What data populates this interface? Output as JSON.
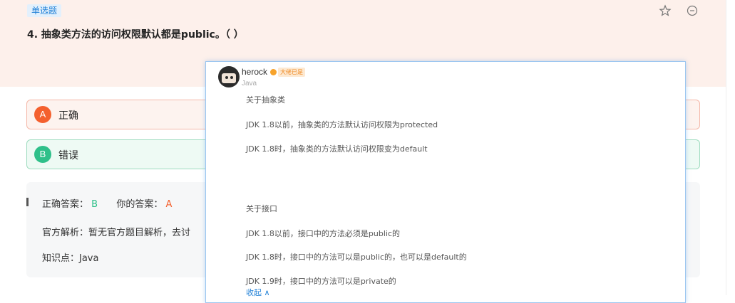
{
  "question": {
    "type_tag": "单选题",
    "title": "4. 抽象类方法的访问权限默认都是public。（ ）",
    "favorite_icon": "star-icon",
    "more_icon": "minus-circle-icon"
  },
  "options": [
    {
      "letter": "A",
      "text": "正确"
    },
    {
      "letter": "B",
      "text": "错误"
    }
  ],
  "analysis": {
    "correct_label": "正确答案：",
    "correct_value": "B",
    "yours_label": "你的答案：",
    "yours_value": "A",
    "official": "官方解析：暂无官方题目解析，去讨",
    "knowledge": "知识点：Java"
  },
  "comment": {
    "username": "herock",
    "level": "大佬已是",
    "usertag": "Java",
    "lines": [
      "关于抽象类",
      "JDK 1.8以前，抽象类的方法默认访问权限为protected",
      "JDK 1.8时，抽象类的方法默认访问权限变为default",
      "关于接口",
      "JDK 1.8以前，接口中的方法必须是public的",
      "JDK 1.8时，接口中的方法可以是public的，也可以是default的",
      "JDK 1.9时，接口中的方法可以是private的"
    ],
    "collapse": "收起 ∧"
  },
  "colors": {
    "accent_blue": "#1e7fd6",
    "wrong_orange": "#f4602e",
    "right_green": "#2fc08a"
  }
}
